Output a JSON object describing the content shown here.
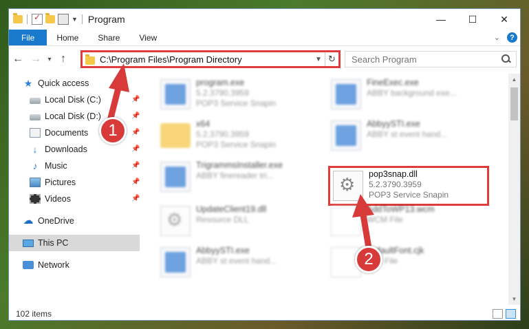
{
  "window": {
    "title": "Program"
  },
  "ribbon": {
    "tabs": [
      {
        "label": "File"
      },
      {
        "label": "Home"
      },
      {
        "label": "Share"
      },
      {
        "label": "View"
      }
    ]
  },
  "window_buttons": {
    "minimize": "—",
    "maximize": "☐",
    "close": "✕"
  },
  "address": {
    "path": "C:\\Program Files\\Program Directory"
  },
  "search": {
    "placeholder": "Search Program"
  },
  "nav": {
    "items": [
      {
        "label": "Quick access",
        "icon": "star-icon"
      },
      {
        "label": "Local Disk (C:)",
        "icon": "disk-icon",
        "pinned": true
      },
      {
        "label": "Local Disk (D:)",
        "icon": "disk-icon",
        "pinned": true
      },
      {
        "label": "Documents",
        "icon": "documents-icon",
        "pinned": true
      },
      {
        "label": "Downloads",
        "icon": "download-icon",
        "pinned": true
      },
      {
        "label": "Music",
        "icon": "music-icon",
        "pinned": true
      },
      {
        "label": "Pictures",
        "icon": "pictures-icon",
        "pinned": true
      },
      {
        "label": "Videos",
        "icon": "videos-icon",
        "pinned": true
      },
      {
        "label": "OneDrive",
        "icon": "cloud-icon"
      },
      {
        "label": "This PC",
        "icon": "pc-icon",
        "selected": true
      },
      {
        "label": "Network",
        "icon": "network-icon"
      }
    ]
  },
  "files": [
    {
      "name": "program.exe",
      "line1": "5.2.3790.3959",
      "line2": "POP3 Service Snapin",
      "kind": "exe"
    },
    {
      "name": "FineExec.exe",
      "line1": "ABBY background exe...",
      "line2": "",
      "kind": "exe"
    },
    {
      "name": "x64",
      "line1": "5.2.3790.3959",
      "line2": "POP3 Service Snapin",
      "kind": "folder"
    },
    {
      "name": "AbbyySTI.exe",
      "line1": "ABBY st event hand...",
      "line2": "",
      "kind": "exe"
    },
    {
      "name": "TrigrammsInstaller.exe",
      "line1": "ABBY finereader tri...",
      "line2": "",
      "kind": "exe"
    },
    {
      "name": "pop3snap.dll",
      "line1": "5.2.3790.3959",
      "line2": "POP3 Service Snapin",
      "kind": "dll",
      "highlighted": true
    },
    {
      "name": "UpdateClient19.dll",
      "line1": "Resource DLL",
      "line2": "",
      "kind": "dll"
    },
    {
      "name": "AddToWP13.wcm",
      "line1": "WCM File",
      "line2": "",
      "kind": "doc"
    },
    {
      "name": "AbbyySTI.exe",
      "line1": "ABBY st event hand...",
      "line2": "",
      "kind": "exe"
    },
    {
      "name": "DefaultFont.cjk",
      "line1": "CJK File",
      "line2": "",
      "kind": "doc"
    }
  ],
  "status": {
    "count": "102 items"
  },
  "callouts": [
    {
      "label": "1"
    },
    {
      "label": "2"
    }
  ],
  "colors": {
    "accent": "#1979ca",
    "highlight": "#e03c3c",
    "selection": "#d9d9d9"
  }
}
